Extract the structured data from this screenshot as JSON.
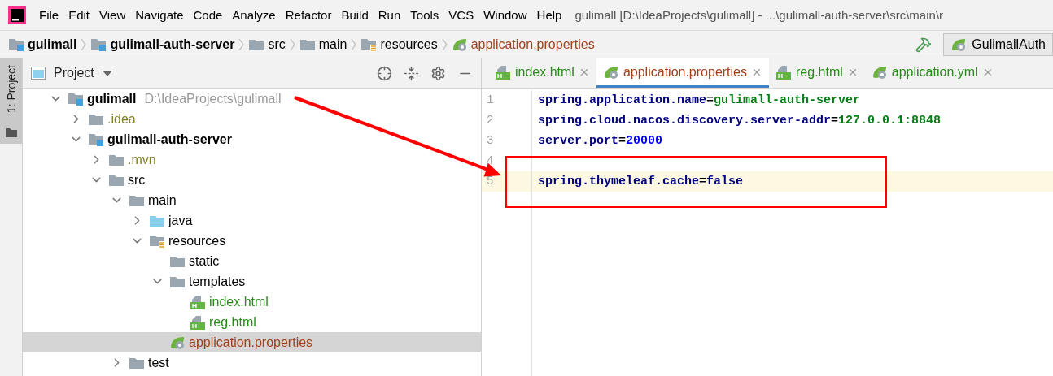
{
  "menu": [
    "File",
    "Edit",
    "View",
    "Navigate",
    "Code",
    "Analyze",
    "Refactor",
    "Build",
    "Run",
    "Tools",
    "VCS",
    "Window",
    "Help"
  ],
  "title": "gulimall [D:\\IdeaProjects\\gulimall] - ...\\gulimall-auth-server\\src\\main\\r",
  "breadcrumbs": [
    {
      "label": "gulimall",
      "kind": "module"
    },
    {
      "label": "gulimall-auth-server",
      "kind": "module"
    },
    {
      "label": "src",
      "kind": "folder"
    },
    {
      "label": "main",
      "kind": "folder"
    },
    {
      "label": "resources",
      "kind": "resources"
    },
    {
      "label": "application.properties",
      "kind": "spring"
    }
  ],
  "run_config": "GulimallAuth",
  "side_tab": {
    "label": "1: Project",
    "selected": true
  },
  "project_panel": {
    "title": "Project",
    "tree": [
      {
        "label": "gulimall",
        "hint": "D:\\IdeaProjects\\gulimall",
        "kind": "module",
        "expanded": true,
        "ignored": false,
        "selected": false,
        "children": [
          {
            "label": ".idea",
            "kind": "folder",
            "expanded": false,
            "ignored": true,
            "selected": false
          },
          {
            "label": "gulimall-auth-server",
            "kind": "module",
            "expanded": true,
            "ignored": false,
            "selected": false,
            "children": [
              {
                "label": ".mvn",
                "kind": "folder",
                "expanded": false,
                "ignored": true,
                "selected": false
              },
              {
                "label": "src",
                "kind": "folder",
                "expanded": true,
                "ignored": false,
                "selected": false,
                "children": [
                  {
                    "label": "main",
                    "kind": "folder",
                    "expanded": true,
                    "ignored": false,
                    "selected": false,
                    "children": [
                      {
                        "label": "java",
                        "kind": "source",
                        "expanded": false,
                        "ignored": false,
                        "selected": false
                      },
                      {
                        "label": "resources",
                        "kind": "resources",
                        "expanded": true,
                        "ignored": false,
                        "selected": false,
                        "children": [
                          {
                            "label": "static",
                            "kind": "folder",
                            "ignored": false,
                            "selected": false
                          },
                          {
                            "label": "templates",
                            "kind": "folder",
                            "expanded": true,
                            "ignored": false,
                            "selected": false,
                            "children": [
                              {
                                "label": "index.html",
                                "kind": "html",
                                "ignored": false,
                                "selected": false
                              },
                              {
                                "label": "reg.html",
                                "kind": "html",
                                "ignored": false,
                                "selected": false
                              }
                            ]
                          },
                          {
                            "label": "application.properties",
                            "kind": "spring",
                            "ignored": false,
                            "selected": true
                          }
                        ]
                      }
                    ]
                  },
                  {
                    "label": "test",
                    "kind": "folder",
                    "expanded": false,
                    "ignored": false,
                    "selected": false
                  }
                ]
              }
            ]
          }
        ]
      }
    ]
  },
  "editor": {
    "tabs": [
      {
        "label": "index.html",
        "kind": "html",
        "selected": false
      },
      {
        "label": "application.properties",
        "kind": "spring",
        "selected": true
      },
      {
        "label": "reg.html",
        "kind": "html",
        "selected": false
      },
      {
        "label": "application.yml",
        "kind": "spring",
        "selected": false
      }
    ],
    "lines": [
      {
        "number": "1",
        "current": false,
        "tokens": [
          {
            "text": "spring.application.name",
            "kind": "key"
          },
          {
            "text": "=",
            "kind": "op"
          },
          {
            "text": "gulimall-auth-server",
            "kind": "string"
          }
        ]
      },
      {
        "number": "2",
        "current": false,
        "tokens": [
          {
            "text": "spring.cloud.nacos.discovery.server-addr",
            "kind": "key"
          },
          {
            "text": "=",
            "kind": "op"
          },
          {
            "text": "127.0.0.1:8848",
            "kind": "string"
          }
        ]
      },
      {
        "number": "3",
        "current": false,
        "tokens": [
          {
            "text": "server.port",
            "kind": "key"
          },
          {
            "text": "=",
            "kind": "op"
          },
          {
            "text": "20000",
            "kind": "number"
          }
        ]
      },
      {
        "number": "4",
        "current": false
      },
      {
        "number": "5",
        "current": true,
        "tokens": [
          {
            "text": "spring.thymeleaf.cache",
            "kind": "key"
          },
          {
            "text": "=",
            "kind": "op"
          },
          {
            "text": "false",
            "kind": "key"
          }
        ]
      }
    ]
  }
}
